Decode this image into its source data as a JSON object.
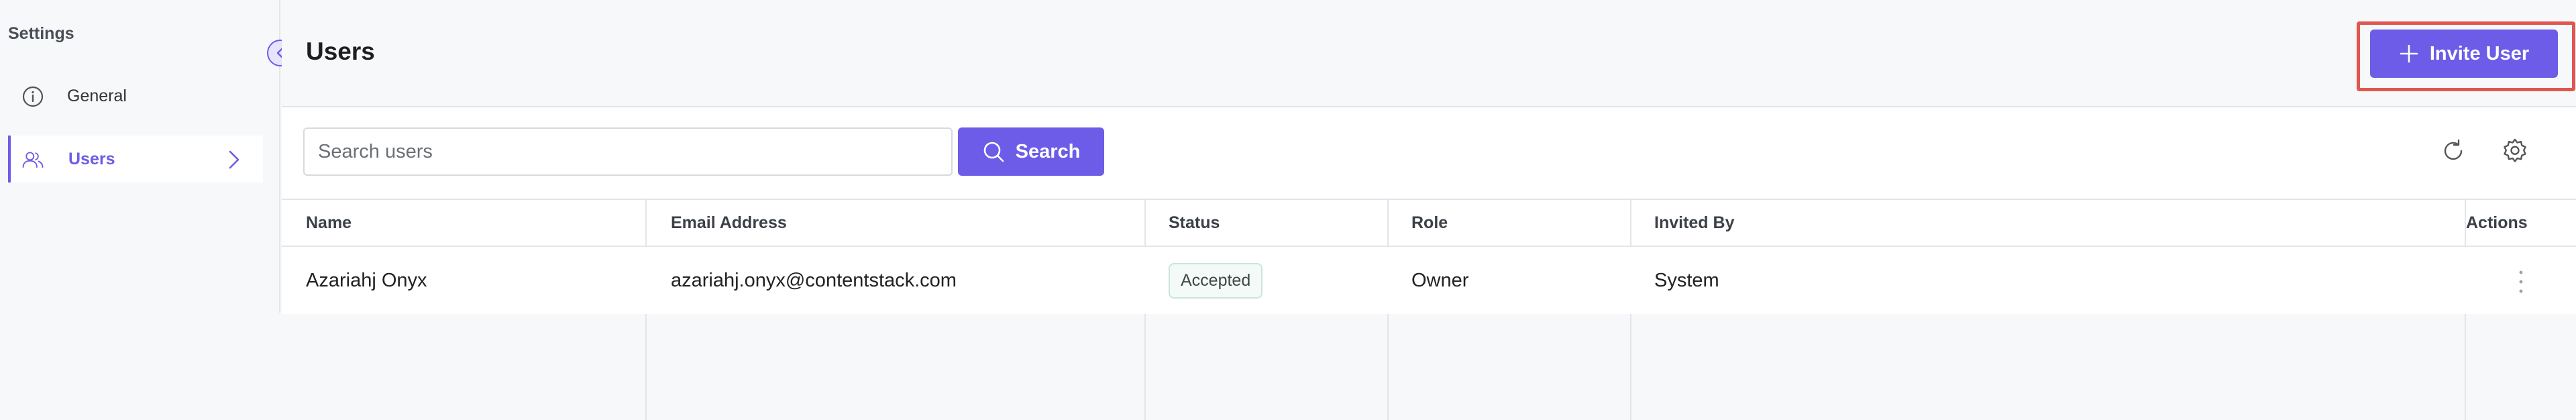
{
  "sidebar": {
    "title": "Settings",
    "items": [
      {
        "label": "General",
        "icon": "info-icon"
      },
      {
        "label": "Users",
        "icon": "users-icon",
        "active": true
      }
    ]
  },
  "header": {
    "title": "Users",
    "invite_label": "Invite User"
  },
  "search": {
    "placeholder": "Search users",
    "value": "",
    "button_label": "Search"
  },
  "table": {
    "columns": [
      "Name",
      "Email Address",
      "Status",
      "Role",
      "Invited By",
      "Actions"
    ],
    "rows": [
      {
        "name": "Azariahj Onyx",
        "email": "azariahj.onyx@contentstack.com",
        "status": "Accepted",
        "role": "Owner",
        "invited_by": "System"
      }
    ]
  },
  "colors": {
    "accent": "#6c5ce7",
    "highlight_border": "#e0574f",
    "badge_border": "#c9e6d9"
  }
}
